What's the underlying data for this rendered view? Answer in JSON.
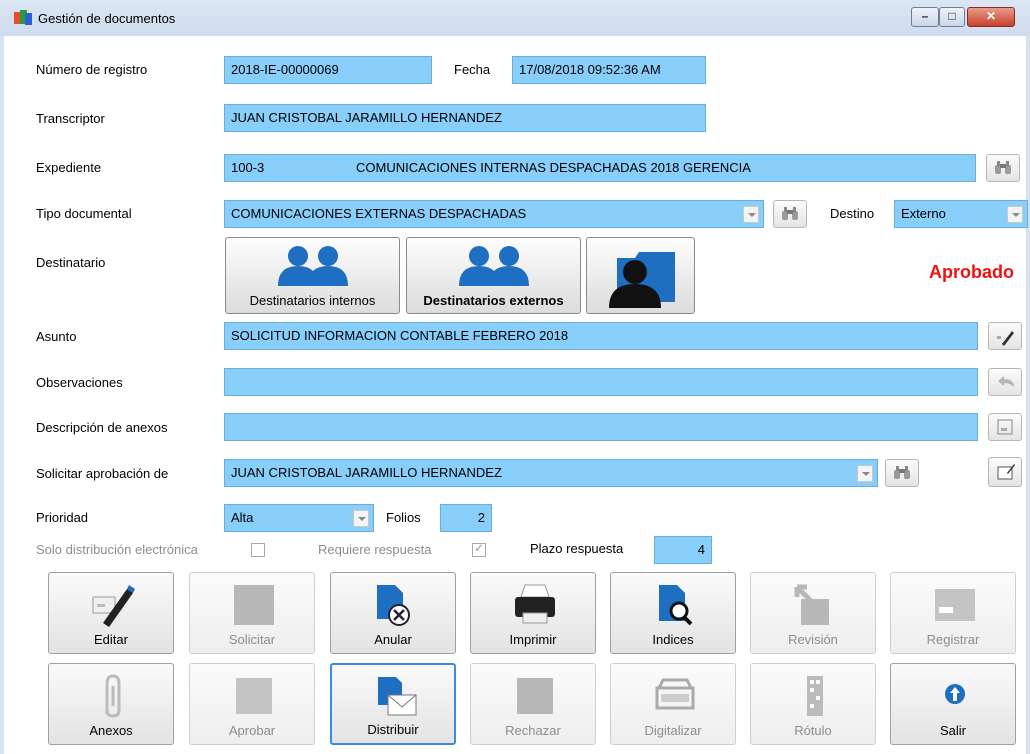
{
  "window": {
    "title": "Gestión de documentos",
    "controls": {
      "minimize": "–",
      "maximize": "□",
      "close": "✕"
    }
  },
  "form": {
    "registro_label": "Número de registro",
    "registro_value": "2018-IE-00000069",
    "fecha_label": "Fecha",
    "fecha_value": "17/08/2018 09:52:36 AM",
    "transcriptor_label": "Transcriptor",
    "transcriptor_value": "JUAN CRISTOBAL JARAMILLO HERNANDEZ",
    "expediente_label": "Expediente",
    "expediente_code": "100-3",
    "expediente_name": "COMUNICACIONES INTERNAS DESPACHADAS 2018 GERENCIA",
    "tipo_label": "Tipo documental",
    "tipo_value": "COMUNICACIONES EXTERNAS DESPACHADAS",
    "destino_label": "Destino",
    "destino_value": "Externo",
    "destinatario_label": "Destinatario",
    "dest_internos": "Destinatarios internos",
    "dest_externos": "Destinatarios externos",
    "status": "Aprobado",
    "asunto_label": "Asunto",
    "asunto_value": "SOLICITUD INFORMACION CONTABLE FEBRERO 2018",
    "observaciones_label": "Observaciones",
    "observaciones_value": "",
    "anexos_label": "Descripción de anexos",
    "anexos_value": "",
    "aprobacion_label": "Solicitar aprobación de",
    "aprobacion_value": "JUAN CRISTOBAL JARAMILLO HERNANDEZ",
    "prioridad_label": "Prioridad",
    "prioridad_value": "Alta",
    "folios_label": "Folios",
    "folios_value": "2",
    "solo_label": "Solo distribución electrónica",
    "solo_checked": false,
    "requiere_label": "Requiere respuesta",
    "requiere_checked": true,
    "plazo_label": "Plazo respuesta",
    "plazo_value": "4"
  },
  "actions": {
    "editar": "Editar",
    "solicitar": "Solicitar",
    "anular": "Anular",
    "imprimir": "Imprimir",
    "indices": "Indices",
    "revision": "Revisión",
    "registrar": "Registrar",
    "anexos": "Anexos",
    "aprobar": "Aprobar",
    "distribuir": "Distribuir",
    "rechazar": "Rechazar",
    "digitalizar": "Digitalizar",
    "rotulo": "Rótulo",
    "salir": "Salir"
  },
  "colors": {
    "field": "#87cefa",
    "status": "#ee1111",
    "icon_blue": "#1e6fc1"
  },
  "icons": [
    "app-icon",
    "binoculars-icon",
    "users-icon",
    "person-folder-icon",
    "pen-icon",
    "undo-icon",
    "form-icon",
    "list-edit-icon",
    "doc-cancel-icon",
    "printer-icon",
    "doc-search-icon",
    "arrow-doc-icon",
    "register-icon",
    "paperclip-icon",
    "mail-doc-icon",
    "scanner-icon",
    "label-icon",
    "exit-icon"
  ]
}
